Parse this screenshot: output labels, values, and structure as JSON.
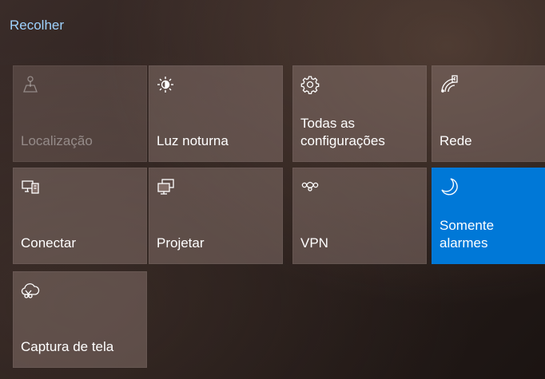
{
  "header": {
    "collapse_label": "Recolher"
  },
  "tiles": [
    {
      "label": "Localização",
      "icon": "location-icon",
      "state": "disabled"
    },
    {
      "label": "Luz noturna",
      "icon": "night-light-icon",
      "state": "normal"
    },
    {
      "label": "Todas as configurações",
      "icon": "gear-icon",
      "state": "normal"
    },
    {
      "label": "Rede",
      "icon": "network-icon",
      "state": "normal"
    },
    {
      "label": "Conectar",
      "icon": "connect-icon",
      "state": "normal"
    },
    {
      "label": "Projetar",
      "icon": "project-icon",
      "state": "normal"
    },
    {
      "label": "VPN",
      "icon": "vpn-icon",
      "state": "normal"
    },
    {
      "label": "Somente alarmes",
      "icon": "moon-icon",
      "state": "active"
    },
    {
      "label": "Captura de tela",
      "icon": "screen-snip-icon",
      "state": "normal"
    }
  ],
  "colors": {
    "accent": "#0078d7",
    "link": "#9fd3ff",
    "tile": "#84706a"
  }
}
